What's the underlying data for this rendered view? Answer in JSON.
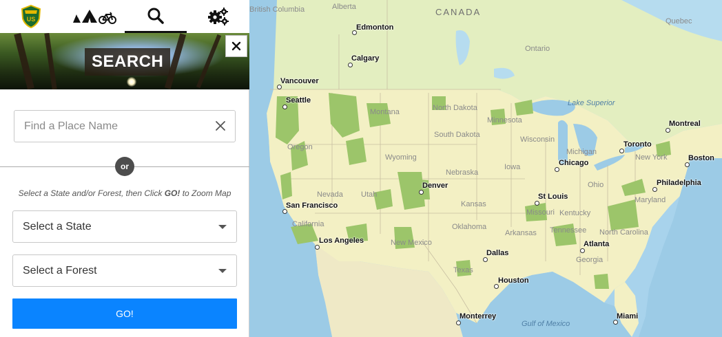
{
  "nav": {
    "shield_text": "US",
    "tabs": [
      "usfs-shield",
      "recreation",
      "search",
      "settings"
    ]
  },
  "banner": {
    "title": "SEARCH"
  },
  "search": {
    "placeholder": "Find a Place Name",
    "or_label": "or",
    "instruction_pre": "Select a State and/or Forest, then Click ",
    "instruction_go": "GO!",
    "instruction_post": " to Zoom Map",
    "state_select": "Select a State",
    "forest_select": "Select a Forest",
    "go_label": "GO!"
  },
  "colors": {
    "accent": "#0a84ff",
    "land": "#f3f0c4",
    "forest": "#9cc56a",
    "water": "#a8d3ec",
    "canada": "#e3eec0"
  },
  "map": {
    "countries": [
      "CANADA"
    ],
    "cities": [
      "Edmonton",
      "Calgary",
      "Vancouver",
      "Seattle",
      "San Francisco",
      "Los Angeles",
      "Denver",
      "Chicago",
      "Toronto",
      "Montreal",
      "Boston",
      "Philadelphia",
      "St Louis",
      "Atlanta",
      "Dallas",
      "Houston",
      "Monterrey",
      "Miami"
    ],
    "regions": [
      "British Columbia",
      "Alberta",
      "Ontario",
      "Quebec",
      "Montana",
      "North Dakota",
      "South Dakota",
      "Minnesota",
      "Wisconsin",
      "Michigan",
      "Wyoming",
      "Oregon",
      "Nebraska",
      "Iowa",
      "Nevada",
      "Utah",
      "Kansas",
      "Missouri",
      "Ohio",
      "New York",
      "California",
      "Oklahoma",
      "Kentucky",
      "Tennessee",
      "New Mexico",
      "Arkansas",
      "North Carolina",
      "Georgia",
      "Texas",
      "Maryland"
    ],
    "water": [
      "Lake Superior",
      "Gulf of Mexico"
    ]
  }
}
